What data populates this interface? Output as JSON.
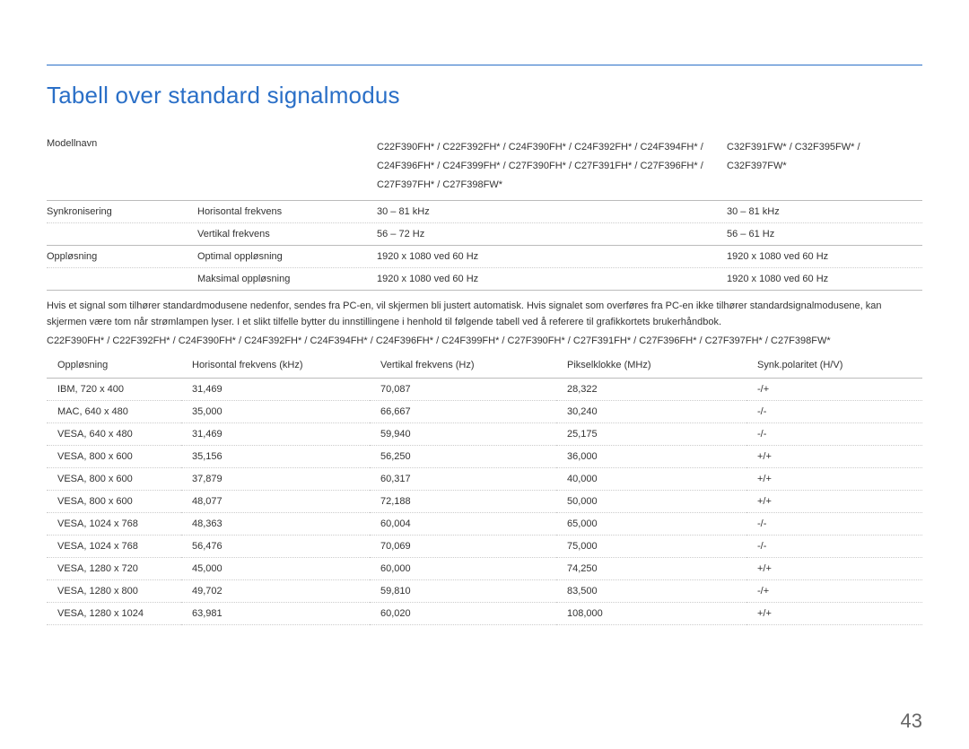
{
  "title": "Tabell over standard signalmodus",
  "page_number": "43",
  "spec": {
    "model_label": "Modellnavn",
    "models_col1": "C22F390FH* / C22F392FH* / C24F390FH* / C24F392FH* / C24F394FH* / C24F396FH* / C24F399FH* / C27F390FH* / C27F391FH* / C27F396FH* / C27F397FH* / C27F398FW*",
    "models_col2": "C32F391FW* / C32F395FW* / C32F397FW*",
    "sync_label": "Synkronisering",
    "hfreq_label": "Horisontal frekvens",
    "hfreq_v1": "30 – 81 kHz",
    "hfreq_v2": "30 – 81 kHz",
    "vfreq_label": "Vertikal frekvens",
    "vfreq_v1": "56 – 72 Hz",
    "vfreq_v2": "56 – 61 Hz",
    "res_label": "Oppløsning",
    "optres_label": "Optimal oppløsning",
    "optres_v1": "1920 x 1080 ved 60 Hz",
    "optres_v2": "1920 x 1080 ved 60 Hz",
    "maxres_label": "Maksimal oppløsning",
    "maxres_v1": "1920 x 1080 ved 60 Hz",
    "maxres_v2": "1920 x 1080 ved 60 Hz"
  },
  "paragraph": "Hvis et signal som tilhører standardmodusene nedenfor, sendes fra PC-en, vil skjermen bli justert automatisk. Hvis signalet som overføres fra PC-en ikke tilhører standardsignalmodusene, kan skjermen være tom når strømlampen lyser. I et slikt tilfelle bytter du innstillingene i henhold til følgende tabell ved å referere til grafikkortets brukerhåndbok.",
  "models_line": "C22F390FH* / C22F392FH* / C24F390FH* / C24F392FH* / C24F394FH* / C24F396FH* / C24F399FH* / C27F390FH* / C27F391FH* / C27F396FH* / C27F397FH* / C27F398FW*",
  "signal_headers": {
    "c1": "Oppløsning",
    "c2": "Horisontal frekvens (kHz)",
    "c3": "Vertikal frekvens (Hz)",
    "c4": "Pikselklokke (MHz)",
    "c5": "Synk.polaritet (H/V)"
  },
  "signal_rows": [
    {
      "res": "IBM, 720 x 400",
      "hf": "31,469",
      "vf": "70,087",
      "pc": "28,322",
      "sp": "-/+"
    },
    {
      "res": "MAC, 640 x 480",
      "hf": "35,000",
      "vf": "66,667",
      "pc": "30,240",
      "sp": "-/-"
    },
    {
      "res": "VESA, 640 x 480",
      "hf": "31,469",
      "vf": "59,940",
      "pc": "25,175",
      "sp": "-/-"
    },
    {
      "res": "VESA, 800 x 600",
      "hf": "35,156",
      "vf": "56,250",
      "pc": "36,000",
      "sp": "+/+"
    },
    {
      "res": "VESA, 800 x 600",
      "hf": "37,879",
      "vf": "60,317",
      "pc": "40,000",
      "sp": "+/+"
    },
    {
      "res": "VESA, 800 x 600",
      "hf": "48,077",
      "vf": "72,188",
      "pc": "50,000",
      "sp": "+/+"
    },
    {
      "res": "VESA, 1024 x 768",
      "hf": "48,363",
      "vf": "60,004",
      "pc": "65,000",
      "sp": "-/-"
    },
    {
      "res": "VESA, 1024 x 768",
      "hf": "56,476",
      "vf": "70,069",
      "pc": "75,000",
      "sp": "-/-"
    },
    {
      "res": "VESA, 1280 x 720",
      "hf": "45,000",
      "vf": "60,000",
      "pc": "74,250",
      "sp": "+/+"
    },
    {
      "res": "VESA, 1280 x 800",
      "hf": "49,702",
      "vf": "59,810",
      "pc": "83,500",
      "sp": "-/+"
    },
    {
      "res": "VESA, 1280 x 1024",
      "hf": "63,981",
      "vf": "60,020",
      "pc": "108,000",
      "sp": "+/+"
    }
  ]
}
